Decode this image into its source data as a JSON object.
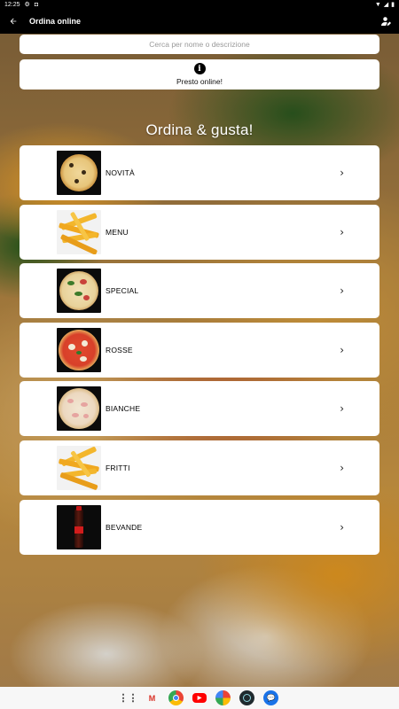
{
  "status": {
    "time": "12:25",
    "left_icons": [
      "settings-gear-icon",
      "app-notification-icon"
    ],
    "right_icons": [
      "wifi-icon",
      "signal-icon",
      "battery-icon"
    ]
  },
  "appbar": {
    "title": "Ordina online",
    "back_icon": "arrow-back-icon",
    "user_icon": "user-icon"
  },
  "search": {
    "placeholder": "Cerca per nome o descrizione"
  },
  "notice": {
    "icon": "info-icon",
    "text": "Presto online!"
  },
  "headline": "Ordina & gusta!",
  "categories": [
    {
      "label": "NOVITÀ",
      "thumb": "pizza-margherita-dark"
    },
    {
      "label": "MENU",
      "thumb": "fries"
    },
    {
      "label": "SPECIAL",
      "thumb": "pizza-special"
    },
    {
      "label": "ROSSE",
      "thumb": "pizza-rossa"
    },
    {
      "label": "BIANCHE",
      "thumb": "pizza-bianca"
    },
    {
      "label": "FRITTI",
      "thumb": "fries"
    },
    {
      "label": "BEVANDE",
      "thumb": "cola-bottle"
    }
  ],
  "navbar": {
    "apps": [
      "app-drawer-icon",
      "gmail-icon",
      "chrome-icon",
      "youtube-icon",
      "photos-icon",
      "camera-app-icon",
      "messages-icon"
    ]
  },
  "colors": {
    "appbar_bg": "#000000",
    "card_bg": "#ffffff",
    "headline": "#ffffff"
  }
}
